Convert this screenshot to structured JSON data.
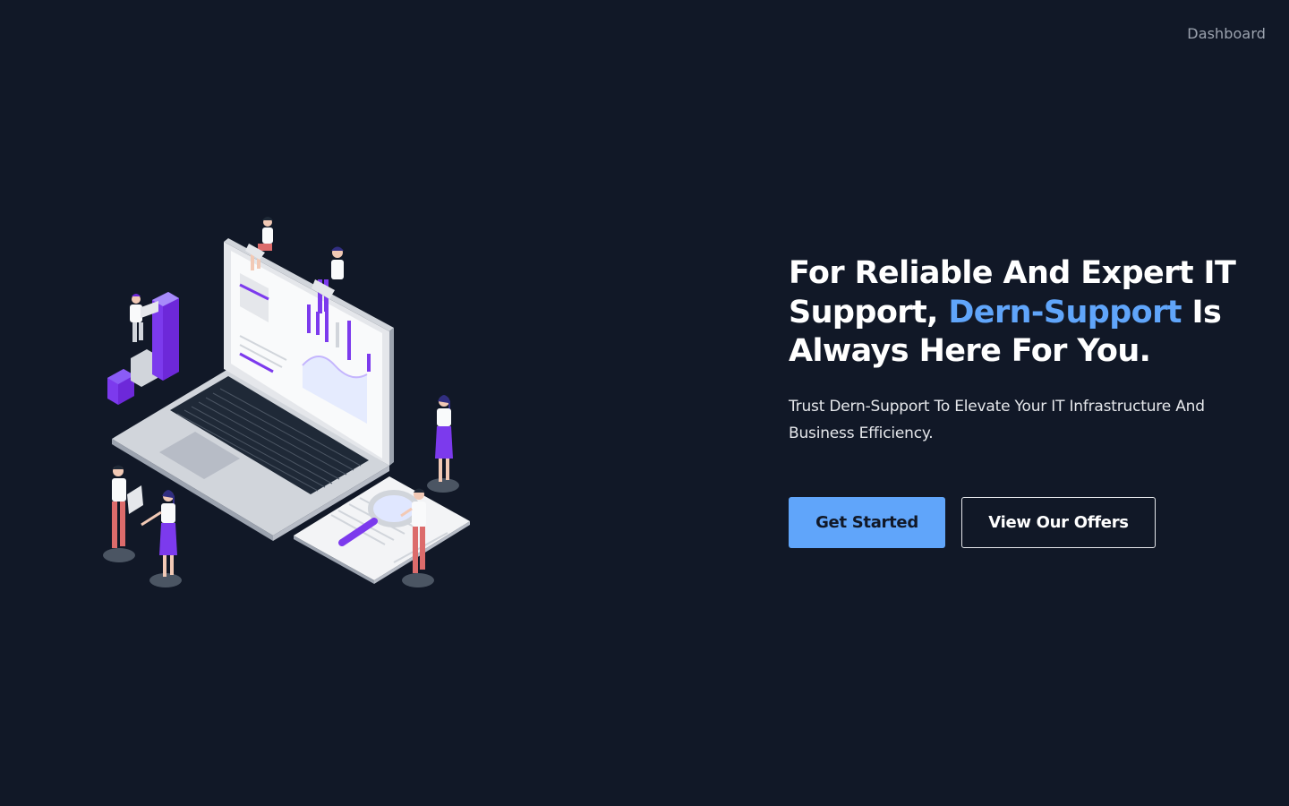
{
  "nav": {
    "dashboard_label": "Dashboard"
  },
  "hero": {
    "title_part1": "For Reliable And Expert IT Support, ",
    "title_accent": "Dern-Support",
    "title_part2": " Is Always Here For You.",
    "subtitle": "Trust Dern-Support To Elevate Your IT Infrastructure And Business Efficiency.",
    "primary_button": "Get Started",
    "secondary_button": "View Our Offers"
  },
  "colors": {
    "background": "#111827",
    "accent": "#60a5fa",
    "illustration_purple": "#7c3aed",
    "illustration_red": "#dc6b6b"
  },
  "illustration": {
    "icon": "laptop-analytics-team-illustration"
  }
}
